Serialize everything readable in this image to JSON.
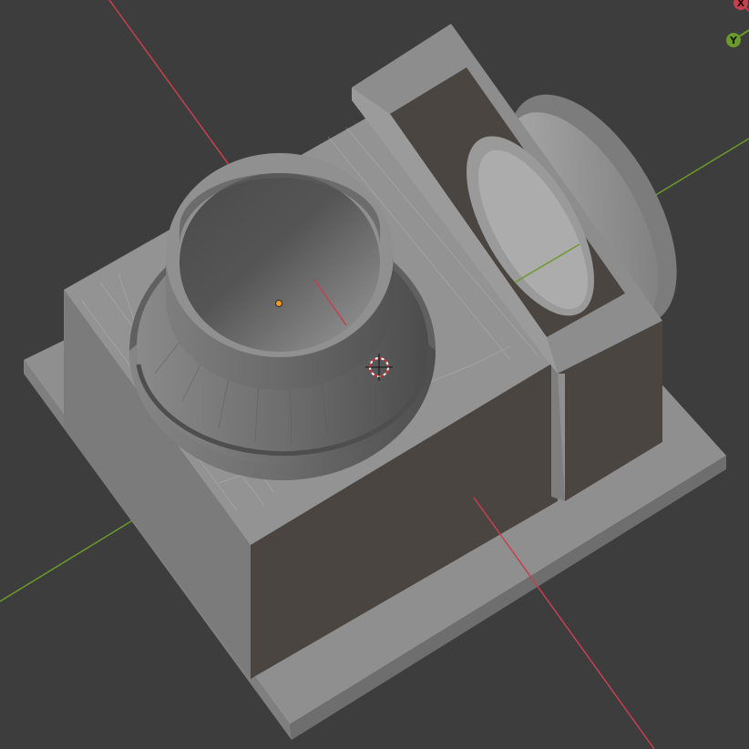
{
  "app": "3D Viewport",
  "colors": {
    "background": "#3d3d3d",
    "grid": "#474747",
    "x_axis": "#c6404f",
    "y_axis": "#6a9a2c",
    "object_origin": "#ff9a20",
    "mesh_face": "#8d8d8d"
  },
  "navigation_gizmo": {
    "x_label": "X",
    "y_label": "Y"
  },
  "icons": {
    "cursor": "3d-cursor-icon",
    "origin": "object-origin-icon"
  }
}
